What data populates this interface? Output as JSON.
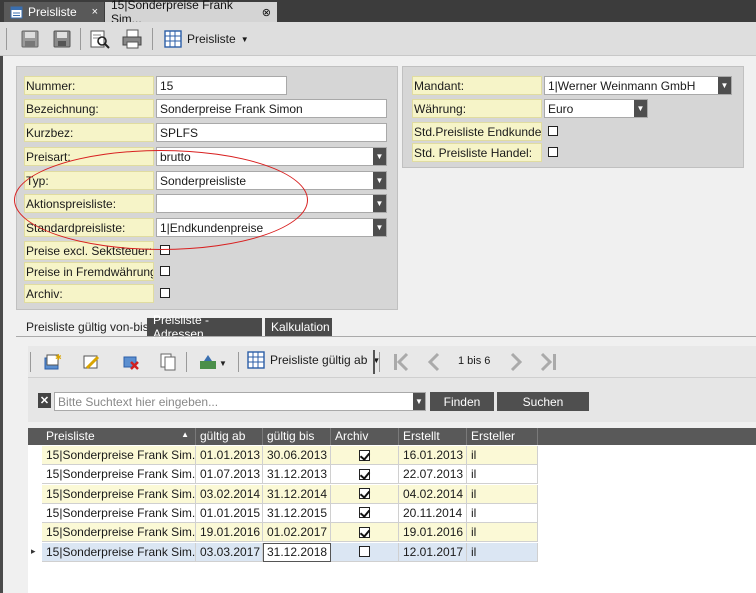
{
  "tabs": [
    {
      "label": "Preisliste",
      "close": "×"
    },
    {
      "label": "15|Sonderpreise Frank Sim...",
      "close": "⊗"
    }
  ],
  "toolbar": {
    "preisliste_label": "Preisliste"
  },
  "form_left": {
    "nummer": {
      "label": "Nummer:",
      "value": "15"
    },
    "bezeichnung": {
      "label": "Bezeichnung:",
      "value": "Sonderpreise Frank Simon"
    },
    "kurzbez": {
      "label": "Kurzbez:",
      "value": "SPLFS"
    },
    "preisart": {
      "label": "Preisart:",
      "value": "brutto"
    },
    "typ": {
      "label": "Typ:",
      "value": "Sonderpreisliste"
    },
    "aktionspreisliste": {
      "label": "Aktionspreisliste:",
      "value": ""
    },
    "standardpreisliste": {
      "label": "Standardpreisliste:",
      "value": "1|Endkundenpreise"
    },
    "excl_sektsteuer": {
      "label": "Preise excl. Sektsteuer:",
      "checked": false
    },
    "fremdwaehrung": {
      "label": "Preise in Fremdwährung:",
      "checked": false
    },
    "archiv": {
      "label": "Archiv:",
      "checked": false
    }
  },
  "form_right": {
    "mandant": {
      "label": "Mandant:",
      "value": "1|Werner Weinmann GmbH"
    },
    "waehrung": {
      "label": "Währung:",
      "value": "Euro"
    },
    "std_endkunden": {
      "label": "Std.Preisliste Endkunden:",
      "checked": false
    },
    "std_handel": {
      "label": "Std. Preisliste Handel:",
      "checked": false
    }
  },
  "subtabs": [
    "Preisliste gültig von-bis",
    "Preisliste - Adressen",
    "Kalkulation"
  ],
  "grid_toolbar": {
    "dropdown_label": "Preisliste gültig ab",
    "page_info": "1 bis 6"
  },
  "search": {
    "placeholder": "Bitte Suchtext hier eingeben...",
    "clear": "✕",
    "find_label": "Finden",
    "search_label": "Suchen"
  },
  "table": {
    "columns": [
      "Preisliste",
      "gültig ab",
      "gültig bis",
      "Archiv",
      "Erstellt",
      "Ersteller"
    ],
    "rows": [
      {
        "preisliste": "15|Sonderpreise Frank Sim...",
        "gueltig_ab": "01.01.2013",
        "gueltig_bis": "30.06.2013",
        "archiv": true,
        "erstellt": "16.01.2013",
        "ersteller": "il"
      },
      {
        "preisliste": "15|Sonderpreise Frank Sim...",
        "gueltig_ab": "01.07.2013",
        "gueltig_bis": "31.12.2013",
        "archiv": true,
        "erstellt": "22.07.2013",
        "ersteller": "il"
      },
      {
        "preisliste": "15|Sonderpreise Frank Sim...",
        "gueltig_ab": "03.02.2014",
        "gueltig_bis": "31.12.2014",
        "archiv": true,
        "erstellt": "04.02.2014",
        "ersteller": "il"
      },
      {
        "preisliste": "15|Sonderpreise Frank Sim...",
        "gueltig_ab": "01.01.2015",
        "gueltig_bis": "31.12.2015",
        "archiv": true,
        "erstellt": "20.11.2014",
        "ersteller": "il"
      },
      {
        "preisliste": "15|Sonderpreise Frank Sim...",
        "gueltig_ab": "19.01.2016",
        "gueltig_bis": "01.02.2017",
        "archiv": true,
        "erstellt": "19.01.2016",
        "ersteller": "il"
      },
      {
        "preisliste": "15|Sonderpreise Frank Sim...",
        "gueltig_ab": "03.03.2017",
        "gueltig_bis": "31.12.2018",
        "archiv": false,
        "erstellt": "12.01.2017",
        "ersteller": "il"
      }
    ]
  },
  "colors": {
    "row_yellow": "#fbf9d6",
    "row_white": "#ffffff",
    "row_selected": "#dbe6f3",
    "header": "#595959",
    "annotation": "#d82020"
  }
}
